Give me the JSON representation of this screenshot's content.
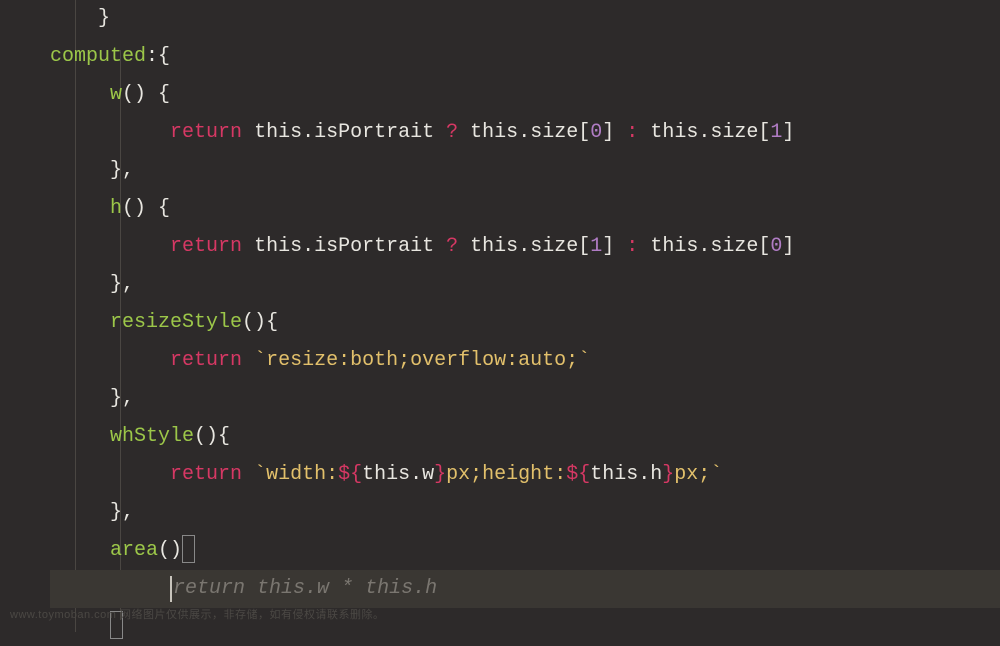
{
  "code": {
    "line0_brace": "}",
    "computed_key": "computed",
    "colon_brace": ":{",
    "w_fn": "w",
    "h_fn": "h",
    "resizeStyle_fn": "resizeStyle",
    "whStyle_fn": "whStyle",
    "area_fn": "area",
    "paren": "()",
    "space_brace": " {",
    "brace_open": "{",
    "brace_close": "}",
    "brace_close_comma": "},",
    "return_kw": "return",
    "this_kw": "this",
    "dot": ".",
    "isPortrait": "isPortrait",
    "size": "size",
    "w_prop": "w",
    "h_prop": "h",
    "ternary_q": "?",
    "ternary_c": ":",
    "num0": "0",
    "num1": "1",
    "lbracket": "[",
    "rbracket": "]",
    "backtick": "`",
    "resize_str": "resize:both;overflow:auto;",
    "width_str1": "width:",
    "width_str2": "px;height:",
    "width_str3": "px;",
    "dollar_open": "${",
    "dollar_close": "}",
    "suggestion": "return this.w * this.h"
  },
  "watermark": "www.toymoban.com 网络图片仅供展示，非存储，如有侵权请联系删除。"
}
